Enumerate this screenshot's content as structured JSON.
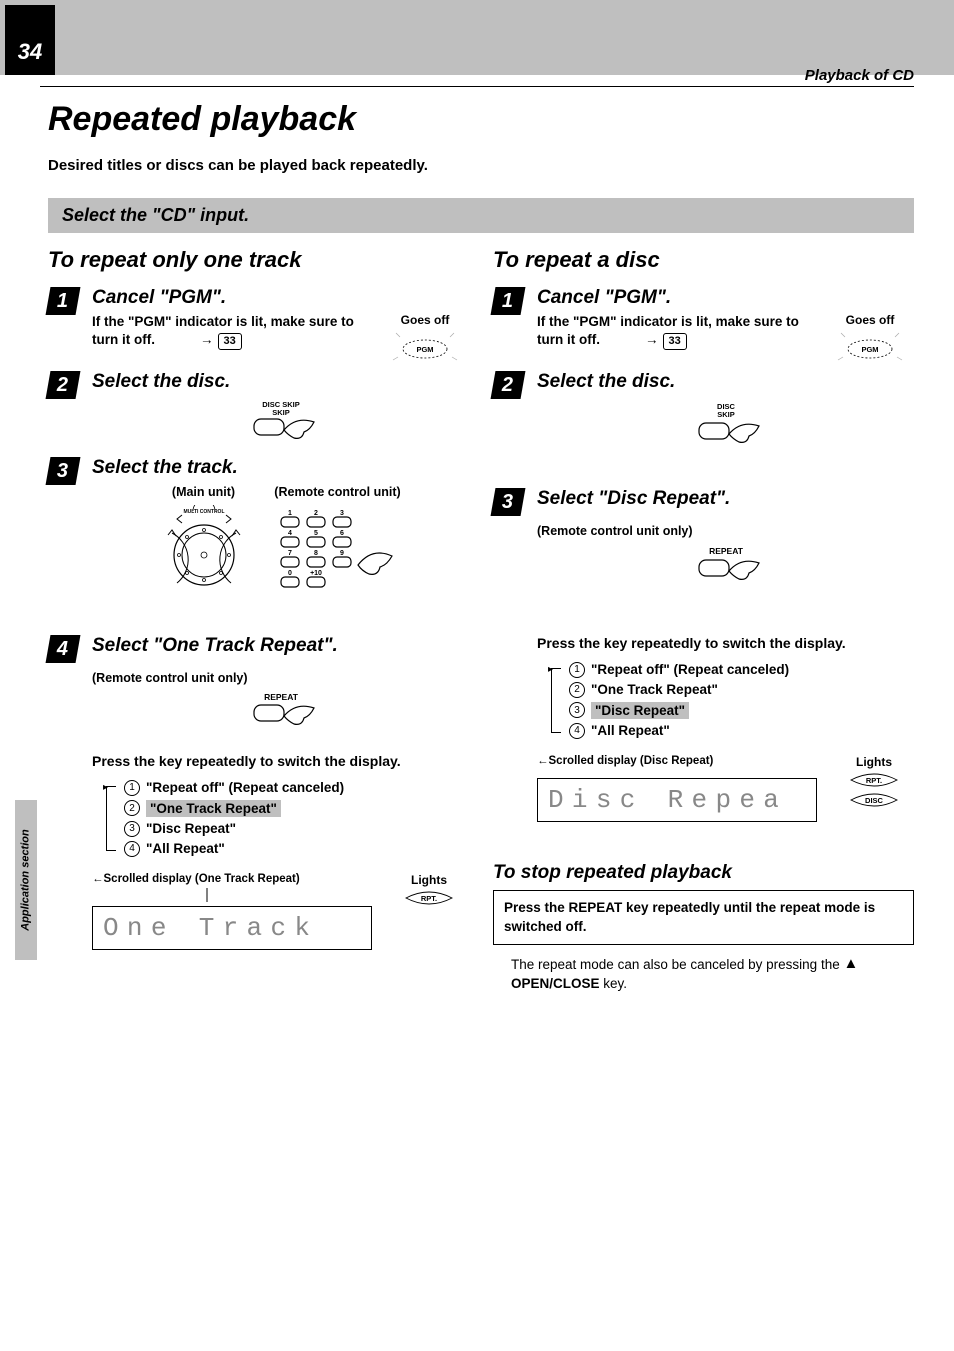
{
  "page_number": "34",
  "section_header": "Playback of CD",
  "side_tab": "Application section",
  "title": "Repeated playback",
  "intro": "Desired titles or discs can be played back repeatedly.",
  "select_input_bar": "Select the \"CD\" input.",
  "left": {
    "heading": "To repeat only one track",
    "step1": {
      "title": "Cancel \"PGM\".",
      "body": "If the \"PGM\" indicator is lit, make sure to turn it off.",
      "ref": "33",
      "goes_off": "Goes off",
      "pgm": "PGM"
    },
    "step2": {
      "title": "Select the disc.",
      "disc_skip": "DISC\nSKIP"
    },
    "step3": {
      "title": "Select the track.",
      "main": "(Main unit)",
      "remote": "(Remote control unit)",
      "jog_label": "MULTI CONTROL"
    },
    "step4": {
      "title": "Select \"One Track Repeat\".",
      "remote_only": "(Remote control unit only)",
      "repeat_label": "REPEAT"
    },
    "press": "Press the key repeatedly to switch the display.",
    "cycle": {
      "i1": "\"Repeat off\" (Repeat canceled)",
      "i2": "\"One Track Repeat\"",
      "i3": "\"Disc  Repeat\"",
      "i4": "\"All  Repeat\""
    },
    "scrolled": "Scrolled display\n(One Track Repeat)",
    "lights": "Lights",
    "rpt": "RPT.",
    "lcd": "One Track"
  },
  "right": {
    "heading": "To repeat a disc",
    "step1": {
      "title": "Cancel \"PGM\".",
      "body": "If the \"PGM\" indicator is lit, make sure to turn it off.",
      "ref": "33",
      "goes_off": "Goes off",
      "pgm": "PGM"
    },
    "step2": {
      "title": "Select the disc.",
      "disc_skip": "DISC\nSKIP"
    },
    "step3": {
      "title": "Select \"Disc Repeat\".",
      "remote_only": "(Remote control unit only)",
      "repeat_label": "REPEAT"
    },
    "press": "Press the key repeatedly to switch the display.",
    "cycle": {
      "i1": "\"Repeat off\" (Repeat canceled)",
      "i2": "\"One Track Repeat\"",
      "i3": "\"Disc  Repeat\"",
      "i4": "\"All  Repeat\""
    },
    "scrolled": "Scrolled display (Disc Repeat)",
    "lights": "Lights",
    "rpt": "RPT.",
    "disc": "DISC",
    "lcd": "Disc Repea"
  },
  "stop": {
    "heading": "To stop repeated playback",
    "box": "Press the REPEAT key repeatedly until the repeat mode is switched off.",
    "note_a": "The repeat mode can also be canceled by pressing the ",
    "note_b": " OPEN/CLOSE",
    "note_c": " key."
  }
}
